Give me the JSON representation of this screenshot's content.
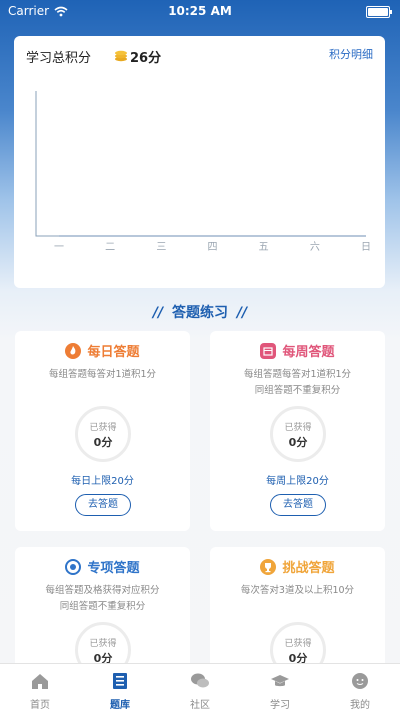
{
  "status_bar": {
    "carrier": "Carrier",
    "time": "10:25 AM"
  },
  "score": {
    "title": "学习总积分",
    "value": "26分",
    "detail_link": "积分明细",
    "coin_color": "#f5c23a"
  },
  "chart_data": {
    "type": "line",
    "categories": [
      "一",
      "二",
      "三",
      "四",
      "五",
      "六",
      "日"
    ],
    "series": [
      {
        "values": [
          0,
          0,
          0,
          0,
          0,
          0,
          0
        ]
      }
    ],
    "axis_color": "#8aa0b8",
    "grid": false
  },
  "section": {
    "title": "答题练习",
    "deco": "//"
  },
  "quiz_cards": [
    {
      "name": "每日答题",
      "desc": [
        "每组答题每答对1道积1分"
      ],
      "ring_label": "已获得",
      "ring_value": "0分",
      "limit": "每日上限20分",
      "button": "去答题",
      "color": "#ee7d35",
      "icon": "flame-icon"
    },
    {
      "name": "每周答题",
      "desc": [
        "每组答题每答对1道积1分",
        "同组答题不重复积分"
      ],
      "ring_label": "已获得",
      "ring_value": "0分",
      "limit": "每周上限20分",
      "button": "去答题",
      "color": "#e0567a",
      "icon": "calendar-icon"
    },
    {
      "name": "专项答题",
      "desc": [
        "每组答题及格获得对应积分",
        "同组答题不重复积分"
      ],
      "ring_label": "已获得",
      "ring_value": "0分",
      "color": "#2f74c9",
      "icon": "target-icon"
    },
    {
      "name": "挑战答题",
      "desc": [
        "每次答对3道及以上积10分"
      ],
      "ring_label": "已获得",
      "ring_value": "0分",
      "color": "#f0a53a",
      "icon": "trophy-icon"
    }
  ],
  "tabs": [
    {
      "label": "首页",
      "icon": "home-icon"
    },
    {
      "label": "题库",
      "icon": "question-bank-icon",
      "active": true
    },
    {
      "label": "社区",
      "icon": "chat-icon"
    },
    {
      "label": "学习",
      "icon": "graduation-cap-icon"
    },
    {
      "label": "我的",
      "icon": "profile-icon"
    }
  ],
  "colors": {
    "accent": "#1e5fb0",
    "tab_inactive": "#8a8a8a"
  }
}
